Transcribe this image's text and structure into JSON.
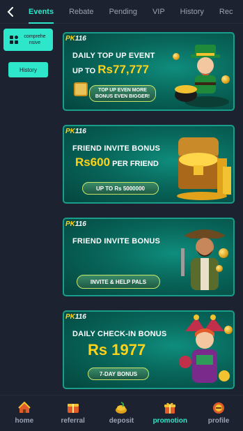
{
  "tabs": [
    "Events",
    "Rebate",
    "Pending",
    "VIP",
    "History",
    "Rec"
  ],
  "active_tab": "Events",
  "sidebar": {
    "category_label": "comprehe nsive",
    "history_label": "History"
  },
  "brand": {
    "pk": "PK",
    "num": "116"
  },
  "banners": [
    {
      "line1": "DAILY TOP UP EVENT",
      "line2_prefix": "UP TO ",
      "line2_value": "Rs77,777",
      "pill": "TOP UP EVEN MORE BONUS EVEN BIGGER!"
    },
    {
      "line1": "FRIEND INVITE BONUS",
      "line2_value": "Rs600",
      "line2_suffix": " PER FRIEND",
      "pill": "UP TO Rs 5000000"
    },
    {
      "line1": "FRIEND INVITE BONUS",
      "pill": "INVITE & HELP PALS"
    },
    {
      "line1": "DAILY CHECK-IN BONUS",
      "line2_value": "Rs 1977",
      "pill": "7-DAY BONUS"
    }
  ],
  "nav": [
    {
      "label": "home",
      "icon": "home-icon"
    },
    {
      "label": "referral",
      "icon": "referral-icon"
    },
    {
      "label": "deposit",
      "icon": "deposit-icon"
    },
    {
      "label": "promotion",
      "icon": "promotion-icon"
    },
    {
      "label": "profile",
      "icon": "profile-icon"
    }
  ],
  "active_nav": "promotion",
  "colors": {
    "accent": "#2ee6c9",
    "background": "#1c2230",
    "gold": "#ffd21a"
  }
}
